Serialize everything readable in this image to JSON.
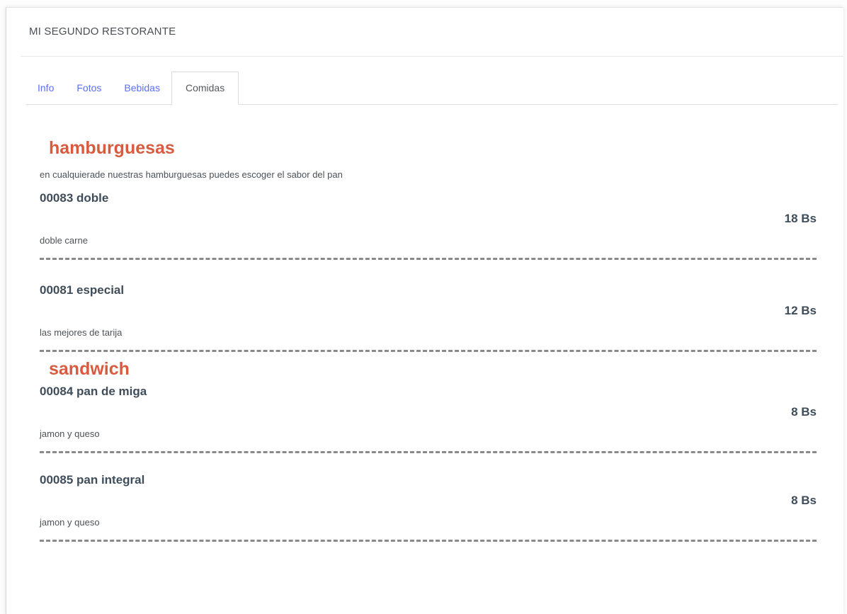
{
  "header": {
    "title": "MI SEGUNDO RESTORANTE"
  },
  "tabs": [
    {
      "label": "Info"
    },
    {
      "label": "Fotos"
    },
    {
      "label": "Bebidas"
    },
    {
      "label": "Comidas"
    }
  ],
  "categories": [
    {
      "title": "hamburguesas",
      "description": "en cualquierade nuestras hamburguesas puedes escoger el sabor del pan",
      "items": [
        {
          "name": "00083 doble",
          "price": "18 Bs",
          "description": "doble carne"
        },
        {
          "name": "00081 especial",
          "price": "12 Bs",
          "description": "las mejores de tarija"
        }
      ]
    },
    {
      "title": "sandwich",
      "items": [
        {
          "name": "00084 pan de miga",
          "price": "8 Bs",
          "description": "jamon y queso"
        },
        {
          "name": "00085 pan integral",
          "price": "8 Bs",
          "description": "jamon y queso"
        }
      ]
    }
  ],
  "colors": {
    "tab_link": "#5b6ff5",
    "category_title": "#d95b3f",
    "item_text": "#3f4c5a"
  }
}
